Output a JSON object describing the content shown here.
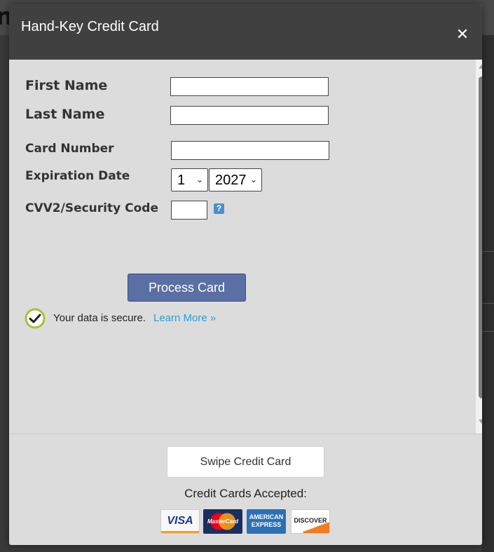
{
  "background": {
    "title_fragment": "n"
  },
  "modal": {
    "title": "Hand-Key Credit Card",
    "close_icon": "close-icon"
  },
  "form": {
    "first_name": {
      "label": "First Name",
      "value": ""
    },
    "last_name": {
      "label": "Last Name",
      "value": ""
    },
    "card_number": {
      "label": "Card Number",
      "value": ""
    },
    "expiration": {
      "label": "Expiration Date",
      "month": "1",
      "year": "2027"
    },
    "cvv": {
      "label": "CVV2/Security Code",
      "value": "",
      "help_icon": "question-icon",
      "help_glyph": "?"
    }
  },
  "actions": {
    "process_label": "Process Card"
  },
  "security": {
    "text": "Your data is secure.",
    "link": "Learn More »",
    "icon": "check-circle-icon"
  },
  "footer": {
    "swipe_label": "Swipe Credit Card",
    "accepted_label": "Credit Cards Accepted:",
    "cards": [
      {
        "name": "visa-logo",
        "text": "VISA"
      },
      {
        "name": "mastercard-logo",
        "text": "MasterCard"
      },
      {
        "name": "amex-logo",
        "text": "AMERICAN EXPRESS"
      },
      {
        "name": "discover-logo",
        "text": "DISCOVER"
      }
    ]
  },
  "colors": {
    "header_bg": "#404040",
    "modal_bg": "#dcdcdc",
    "process_button": "#5a6fa3",
    "link": "#2b9fd6",
    "secure_ring": "#a6c234"
  }
}
